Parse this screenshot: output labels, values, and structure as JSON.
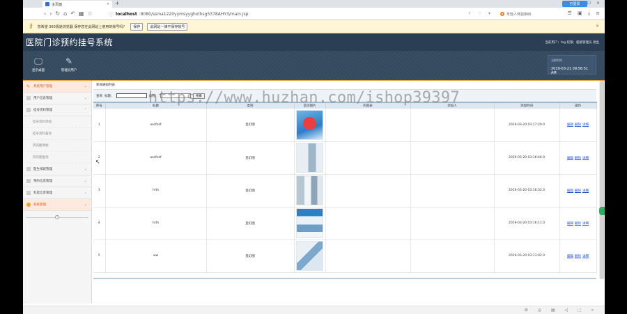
{
  "browser": {
    "tab_title": "主页面",
    "login_label": "已登录",
    "url_host": "localhost",
    "url_rest": ":8080/ssma1220yymsyyghxthsg5378AHY3/main.jsp",
    "search_placeholder": "年轻人体验柳树",
    "notice_text": "您希望 360极速浏览器 保存您在此网站上使用的帐号吗？",
    "notice_save": "保存",
    "notice_never": "此网站一律不保存帐号"
  },
  "app": {
    "title": "医院门诊预约挂号系统",
    "user_info": "当前用户：fog 权限：超级管理员 退出",
    "nav": [
      {
        "label": "显示桌面"
      },
      {
        "label": "管理员用户"
      }
    ],
    "time_label": "当前时间",
    "time_value": "2019-03-21 09:56:51 AM"
  },
  "sidebar": {
    "items": [
      {
        "label": "系统用户管理",
        "active": true
      },
      {
        "label": "用户信息管理"
      },
      {
        "label": "挂号资料管理"
      }
    ],
    "subitems": [
      "挂号资料添加",
      "挂号资料查询",
      "资讯图添加",
      "资讯图查询"
    ],
    "items2": [
      {
        "label": "医生排班管理"
      },
      {
        "label": "预约信息管理"
      },
      {
        "label": "科室信息管理"
      },
      {
        "label": "系统管理",
        "active": true
      }
    ],
    "collapse_icon": "chevron-up-icon"
  },
  "content": {
    "panel_title": "新闻通知列表",
    "search_label": "查询",
    "field1_label": "标题：",
    "field2_label": "类别：",
    "search_button": "搜索",
    "columns": [
      "序号",
      "标题",
      "类别",
      "首页图片",
      "内容表",
      "添加人",
      "添加时间",
      "操作"
    ],
    "rows": [
      {
        "no": "1",
        "title": "asdfsdf",
        "category": "变幻图",
        "time": "2019-03-20 03:17:29.0"
      },
      {
        "no": "2",
        "title": "asdfsdf",
        "category": "变幻图",
        "time": "2019-03-20 03:16:46.0"
      },
      {
        "no": "3",
        "title": "hrth",
        "category": "变幻图",
        "time": "2019-03-20 03:16:32.0"
      },
      {
        "no": "4",
        "title": "hrth",
        "category": "变幻图",
        "time": "2019-03-20 03:16:11.0"
      },
      {
        "no": "5",
        "title": "ww",
        "category": "变幻图",
        "time": "2019-03-20 03:13:02.0"
      }
    ],
    "actions": [
      "编辑",
      "删除",
      "详细"
    ]
  },
  "watermark": "https://www.huzhan.com/ishop39397"
}
